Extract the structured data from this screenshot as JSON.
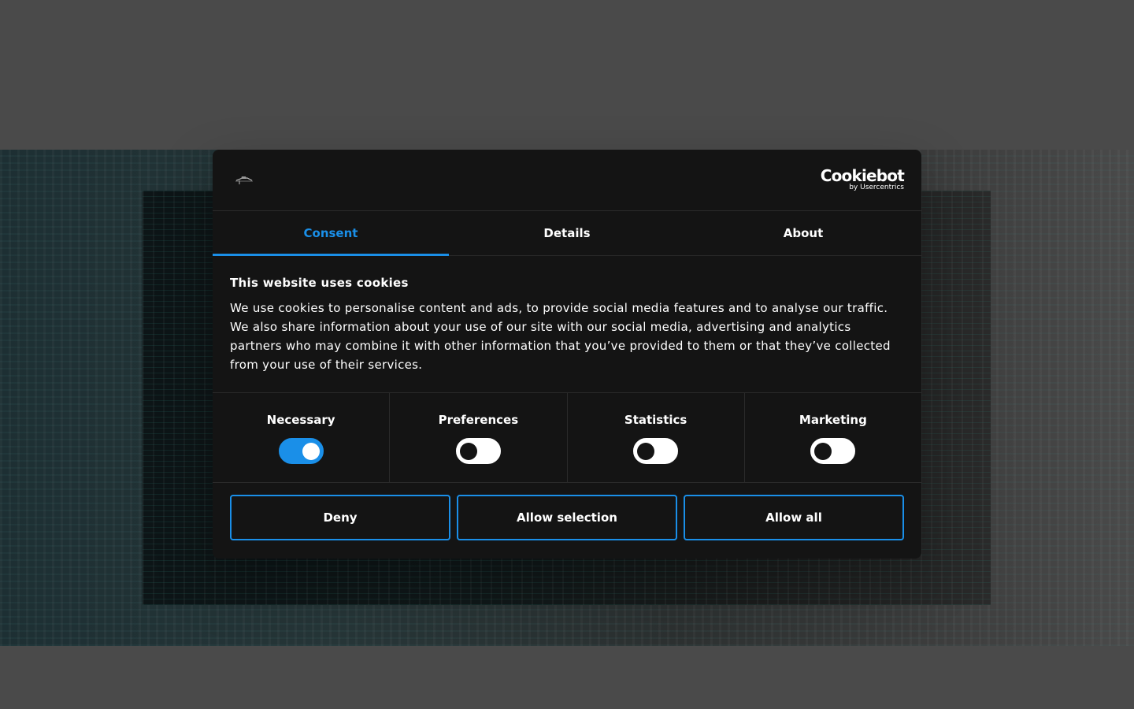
{
  "header": {
    "brand_wordmark": "Cookiebot",
    "brand_sub": "by Usercentrics"
  },
  "tabs": [
    {
      "label": "Consent",
      "active": true
    },
    {
      "label": "Details",
      "active": false
    },
    {
      "label": "About",
      "active": false
    }
  ],
  "consent": {
    "title": "This website uses cookies",
    "text": "We use cookies to personalise content and ads, to provide social media features and to analyse our traffic. We also share information about your use of our site with our social media, advertising and analytics partners who may combine it with other information that you’ve provided to them or that they’ve collected from your use of their services."
  },
  "toggles": [
    {
      "label": "Necessary",
      "on": true
    },
    {
      "label": "Preferences",
      "on": false
    },
    {
      "label": "Statistics",
      "on": false
    },
    {
      "label": "Marketing",
      "on": false
    }
  ],
  "actions": {
    "deny": "Deny",
    "allow_selection": "Allow selection",
    "allow_all": "Allow all"
  },
  "colors": {
    "accent": "#1a8fe8",
    "dialog_bg": "#141414",
    "page_bg": "#4a4a4a"
  }
}
